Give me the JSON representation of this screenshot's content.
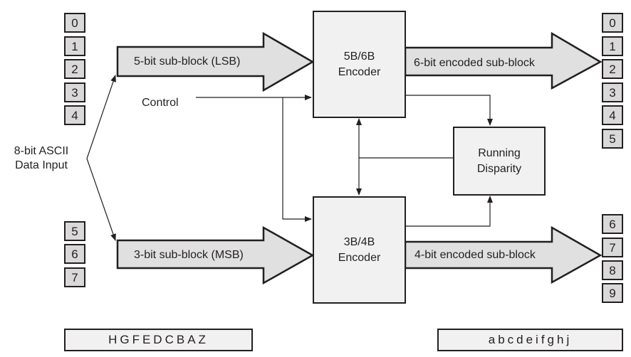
{
  "diagram": {
    "input_label_line1": "8-bit ASCII",
    "input_label_line2": "Data Input",
    "control_label": "Control",
    "input_bits_lsb": [
      "0",
      "1",
      "2",
      "3",
      "4"
    ],
    "input_bits_msb": [
      "5",
      "6",
      "7"
    ],
    "output_bits_6b": [
      "0",
      "1",
      "2",
      "3",
      "4",
      "5"
    ],
    "output_bits_4b": [
      "6",
      "7",
      "8",
      "9"
    ],
    "arrows": {
      "lsb": "5-bit sub-block (LSB)",
      "msb": "3-bit sub-block (MSB)",
      "out6": "6-bit encoded sub-block",
      "out4": "4-bit encoded sub-block"
    },
    "blocks": {
      "enc56_line1": "5B/6B",
      "enc56_line2": "Encoder",
      "enc34_line1": "3B/4B",
      "enc34_line2": "Encoder",
      "rd_line1": "Running",
      "rd_line2": "Disparity"
    },
    "input_letters": "HGFEDCBAZ",
    "output_letters": "abcdeifghj",
    "colors": {
      "arrow_fill": "#e0e0e0",
      "block_fill": "#f1f1f1",
      "cell_fill": "#d9d9d9",
      "stroke": "#231f20"
    }
  }
}
